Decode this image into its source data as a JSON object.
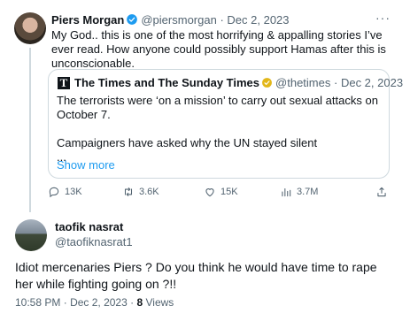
{
  "original_tweet": {
    "author_name": "Piers Morgan",
    "handle": "@piersmorgan",
    "separator": "·",
    "date": "Dec 2, 2023",
    "more_label": "···",
    "text": "My God.. this is one of the most horrifying & appalling stories I’ve ever read. How anyone could possibly support Hamas after this is unconscionable.",
    "quote": {
      "logo_letter": "T",
      "author_name": "The Times and The Sunday Times",
      "handle": "@thetimes",
      "separator": "·",
      "date": "Dec 2, 2023",
      "line1": "The terrorists were ‘on a mission’ to carry out sexual attacks on October 7.",
      "line2": "Campaigners have asked why the UN stayed silent",
      "ellipsis": "...",
      "show_more": "Show more"
    },
    "actions": {
      "replies": "13K",
      "reposts": "3.6K",
      "likes": "15K",
      "views": "3.7M"
    },
    "icons": [
      "reply-icon",
      "repost-icon",
      "like-icon",
      "views-icon",
      "share-icon",
      "verified-badge-icon",
      "more-icon"
    ],
    "colors": {
      "verified_blue": "#1d9bf0",
      "verified_gold": "#e2b719",
      "link": "#1d9bf0",
      "muted": "#536471"
    }
  },
  "reply": {
    "author_name": "taofik nasrat",
    "handle": "@taofiknasrat1",
    "text": "Idiot mercenaries Piers ? Do you think he would have time to rape her while fighting going on ?!!",
    "time": "10:58 PM",
    "separator": "·",
    "date": "Dec 2, 2023",
    "separator2": "·",
    "views_count": "8",
    "views_label": "Views"
  }
}
